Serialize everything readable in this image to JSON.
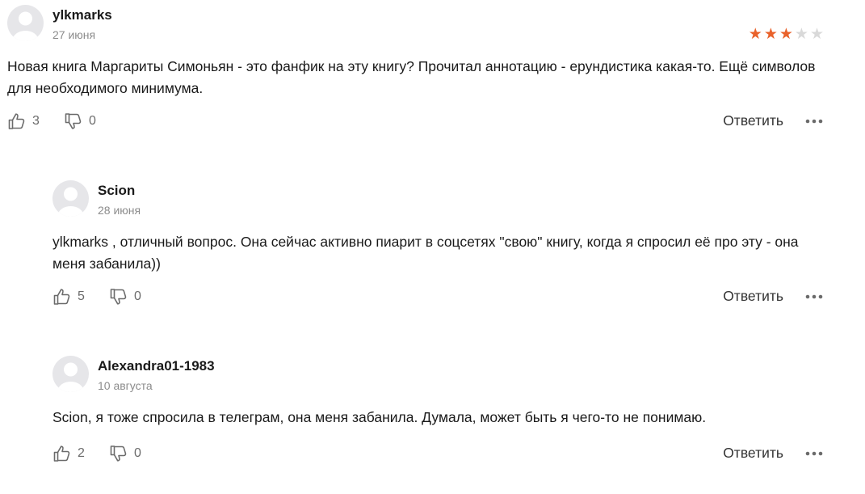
{
  "colors": {
    "star_active": "#e9622b",
    "star_inactive": "#d9d9d9",
    "date": "#8c8c8c",
    "avatar_bg": "#e6e6e9"
  },
  "icons": {
    "avatar": "default-user-avatar",
    "like": "thumbs-up-icon",
    "dislike": "thumbs-down-icon",
    "more": "more-dots-icon",
    "star": "star-icon"
  },
  "comments": [
    {
      "author": "ylkmarks",
      "date": "27 июня",
      "rating": 3,
      "rating_max": 5,
      "text": "Новая книга Маргариты Симоньян - это фанфик на эту книгу? Прочитал аннотацию - ерундистика какая-то. Ещё символов для необходимого минимума.",
      "likes": "3",
      "dislikes": "0",
      "reply_label": "Ответить"
    },
    {
      "author": "Scion",
      "date": "28 июня",
      "text": "ylkmarks , отличный вопрос. Она сейчас активно пиарит в соцсетях \"свою\" книгу, когда я спросил её про эту - она меня забанила))",
      "likes": "5",
      "dislikes": "0",
      "reply_label": "Ответить"
    },
    {
      "author": "Alexandra01-1983",
      "date": "10 августа",
      "text": "Scion, я тоже спросила в телеграм, она меня забанила. Думала, может быть я чего-то не понимаю.",
      "likes": "2",
      "dislikes": "0",
      "reply_label": "Ответить"
    }
  ]
}
